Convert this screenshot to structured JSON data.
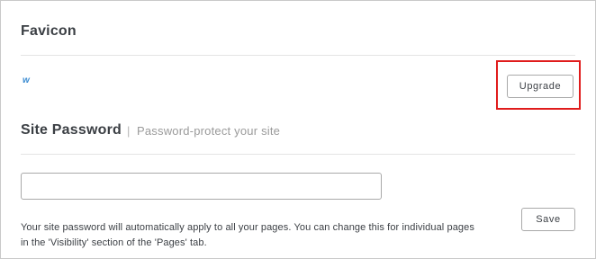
{
  "favicon": {
    "heading": "Favicon",
    "icon_glyph": "w",
    "icon_name": "weebly-favicon-icon",
    "icon_color": "#3a8bd1",
    "upgrade_label": "Upgrade"
  },
  "site_password": {
    "heading": "Site Password",
    "separator": "|",
    "subheading": "Password-protect your site",
    "input_value": "",
    "input_placeholder": "",
    "help_line_1": "Your site password will automatically apply to all your pages. You can change this for individual pages",
    "help_line_2": "in the 'Visibility' section of the 'Pages' tab.",
    "save_label": "Save"
  },
  "colors": {
    "highlight_border": "#e01c1c",
    "text": "#3b3f44",
    "muted_text": "#9a9a9a"
  }
}
